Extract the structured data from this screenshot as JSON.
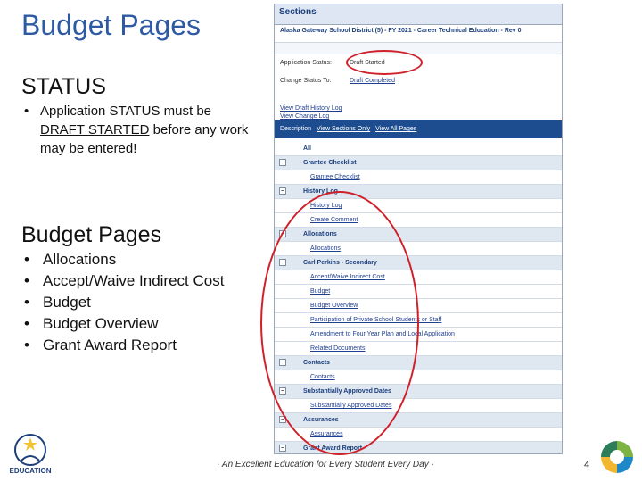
{
  "slide": {
    "title": "Budget Pages",
    "status_heading": "STATUS",
    "status_bullet_pre": "Application STATUS must be ",
    "status_bullet_underlined": "DRAFT STARTED",
    "status_bullet_post": " before any work may be entered!",
    "budget_heading": "Budget Pages",
    "budget_items": [
      "Allocations",
      "Accept/Waive Indirect Cost",
      "Budget",
      "Budget Overview",
      "Grant Award Report"
    ],
    "footer": "· An Excellent Education for Every Student Every Day ·",
    "page_number": "4",
    "logo_text": "EDUCATION"
  },
  "panel": {
    "header": "Sections",
    "district": "Alaska Gateway School District (5) - FY 2021 - Career Technical Education - Rev 0",
    "status_label": "Application Status:",
    "status_value": "Draft Started",
    "change_label": "Change Status To:",
    "change_value": "Draft Completed",
    "history_link": "View Draft History Log",
    "change_log_link": "View Change Log",
    "desc_label": "Description",
    "view_sections_link": "View Sections Only",
    "view_all_link": "View All Pages",
    "rows": [
      {
        "type": "all",
        "label": "All"
      },
      {
        "type": "group",
        "label": "Grantee Checklist"
      },
      {
        "type": "child",
        "label": "Grantee Checklist"
      },
      {
        "type": "group",
        "label": "History Log"
      },
      {
        "type": "child",
        "label": "History Log"
      },
      {
        "type": "child",
        "label": "Create Comment"
      },
      {
        "type": "group",
        "label": "Allocations"
      },
      {
        "type": "child",
        "label": "Allocations"
      },
      {
        "type": "group",
        "label": "Carl Perkins - Secondary"
      },
      {
        "type": "child",
        "label": "Accept/Waive Indirect Cost"
      },
      {
        "type": "child",
        "label": "Budget"
      },
      {
        "type": "child",
        "label": "Budget Overview"
      },
      {
        "type": "child",
        "label": "Participation of Private School Students or Staff"
      },
      {
        "type": "child",
        "label": "Amendment to Four Year Plan and Local Application"
      },
      {
        "type": "child",
        "label": "Related Documents"
      },
      {
        "type": "group",
        "label": "Contacts"
      },
      {
        "type": "child",
        "label": "Contacts"
      },
      {
        "type": "group",
        "label": "Substantially Approved Dates"
      },
      {
        "type": "child",
        "label": "Substantially Approved Dates"
      },
      {
        "type": "group",
        "label": "Assurances"
      },
      {
        "type": "child",
        "label": "Assurances"
      },
      {
        "type": "group",
        "label": "Grant Award Report"
      },
      {
        "type": "child",
        "label": "Grant Award Report"
      }
    ]
  },
  "colors": {
    "title": "#2e5aa3",
    "desc_bar": "#1e4d8f",
    "group_row": "#dfe7f1",
    "highlight_oval": "#d0202a"
  }
}
